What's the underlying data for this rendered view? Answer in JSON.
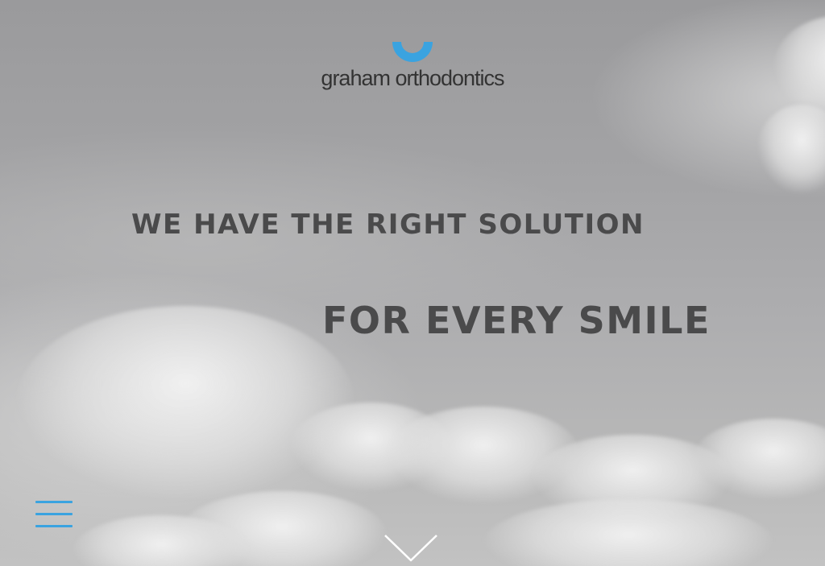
{
  "brand": {
    "name": "graham orthodontics",
    "accent_color": "#3aa3e0",
    "logo_icon": "smile-arc-icon"
  },
  "hero": {
    "headline_line1": "WE HAVE THE RIGHT SOLUTION",
    "headline_line2": "FOR EVERY SMILE",
    "text_color": "#4a4a4b",
    "background": "cloudy-sky-grayscale"
  },
  "controls": {
    "menu_icon": "hamburger-menu-icon",
    "scroll_icon": "chevron-down-icon"
  }
}
